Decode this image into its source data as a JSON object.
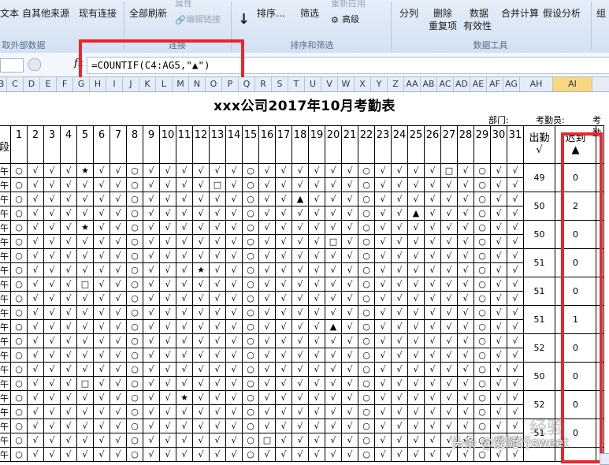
{
  "ribbon": {
    "buttons": [
      "文本",
      "自其他来源",
      "现有连接",
      "全部刷新",
      "属性",
      "编辑链接",
      "排序...",
      "筛选",
      "重新应用",
      "高级",
      "分列",
      "删除",
      "重复项",
      "数据",
      "有效性",
      "合并计算",
      "假设分析",
      "组"
    ],
    "groups": [
      "取外部数据",
      "连接",
      "排序和筛选",
      "数据工具"
    ]
  },
  "formula_bar": {
    "fx": "fx",
    "formula": "=COUNTIF(C4:AG5,\"▲\")"
  },
  "columns": [
    "B",
    "C",
    "D",
    "E",
    "F",
    "G",
    "H",
    "I",
    "J",
    "K",
    "L",
    "M",
    "N",
    "O",
    "P",
    "Q",
    "R",
    "S",
    "T",
    "U",
    "V",
    "W",
    "X",
    "Y",
    "Z",
    "AA",
    "AB",
    "AC",
    "AD",
    "AE",
    "AF",
    "AG",
    "AH",
    "AI"
  ],
  "sheet": {
    "title": "xxx公司2017年10月考勤表",
    "dept_label": "部门:",
    "clerk_label": "考勤员:",
    "clerk_label2": "考勤",
    "period_header": "段",
    "days": [
      "1",
      "2",
      "3",
      "4",
      "5",
      "6",
      "7",
      "8",
      "9",
      "10",
      "11",
      "12",
      "13",
      "14",
      "15",
      "16",
      "17",
      "18",
      "19",
      "20",
      "21",
      "22",
      "23",
      "24",
      "25",
      "26",
      "27",
      "28",
      "29",
      "30",
      "31"
    ],
    "attend_header": "出勤",
    "attend_symbol": "√",
    "late_header": "迟到",
    "late_symbol": "▲",
    "period_cell": "午",
    "marks": {
      "check": "√",
      "circle": "○",
      "star": "★",
      "square": "□",
      "triangle": "▲"
    },
    "attend_values": [
      "49",
      "50",
      "50",
      "51",
      "51",
      "51",
      "52",
      "50",
      "52",
      "51"
    ],
    "late_values": [
      "0",
      "2",
      "0",
      "0",
      "0",
      "1",
      "0",
      "0",
      "0",
      "0"
    ]
  },
  "watermark": {
    "text": "头条 @爱随行sweet",
    "faint": "经验"
  }
}
